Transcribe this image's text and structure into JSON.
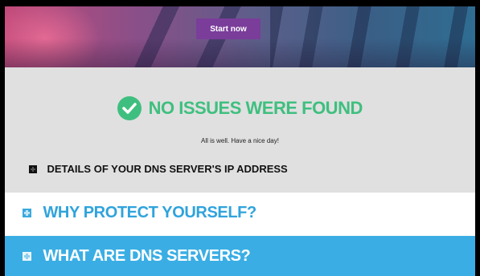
{
  "hero": {
    "start_button_label": "Start now"
  },
  "result": {
    "icon": "check-circle-icon",
    "title": "NO ISSUES WERE FOUND",
    "subtitle": "All is well. Have a nice day!",
    "details_label": "DETAILS OF YOUR DNS SERVER'S IP ADDRESS"
  },
  "sections": {
    "why_label": "WHY PROTECT YOURSELF?",
    "what_label": "WHAT ARE DNS SERVERS?"
  },
  "colors": {
    "success_green": "#3fbf7f",
    "accent_blue": "#3aaee4",
    "button_purple": "#7a3d9a",
    "result_bg": "#e0e0e0"
  }
}
